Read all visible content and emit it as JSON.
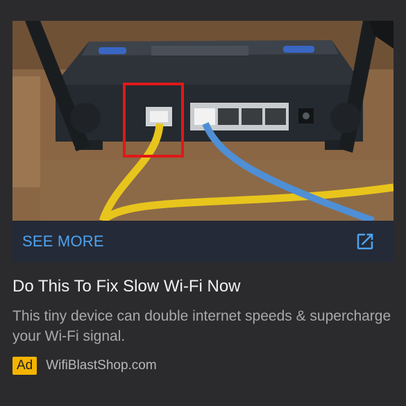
{
  "ad": {
    "see_more_label": "SEE MORE",
    "headline": "Do This To Fix Slow Wi-Fi Now",
    "description": "This tiny device can double internet speeds & supercharge your Wi-Fi signal.",
    "badge": "Ad",
    "advertiser": "WifiBlastShop.com",
    "cta_icon": "open-in-new-icon",
    "photo": "router-back-panel-photo"
  },
  "colors": {
    "background": "#2b2b2d",
    "cta_bar": "#242a37",
    "cta_text": "#4da3f0",
    "badge": "#f4b400",
    "highlight_box": "#e01818",
    "cable_yellow": "#e8c51c",
    "cable_blue": "#4f8fd6"
  }
}
